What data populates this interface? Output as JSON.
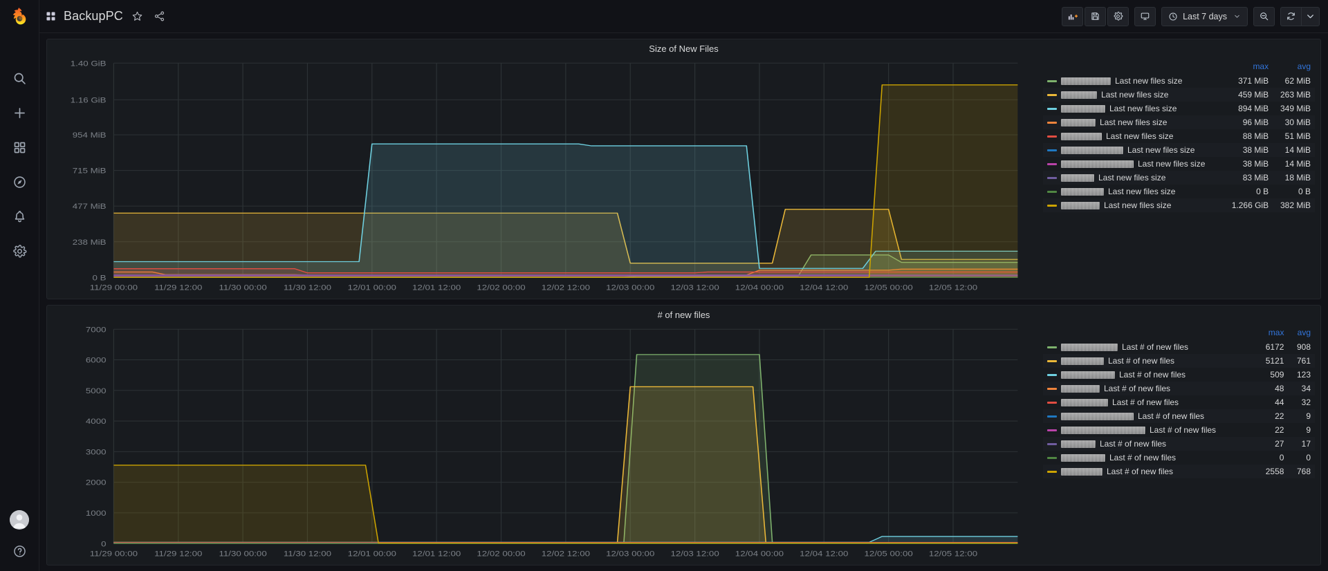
{
  "app": {
    "logo": "grafana-logo",
    "dashboard_title": "BackupPC"
  },
  "sidebar": {
    "items": [
      {
        "name": "search-icon",
        "label": "Search"
      },
      {
        "name": "plus-icon",
        "label": "Create"
      },
      {
        "name": "dashboards-icon",
        "label": "Dashboards"
      },
      {
        "name": "compass-icon",
        "label": "Explore"
      },
      {
        "name": "bell-icon",
        "label": "Alerting"
      },
      {
        "name": "gear-icon",
        "label": "Configuration"
      }
    ],
    "bottom": [
      {
        "name": "avatar",
        "label": "User"
      },
      {
        "name": "help-icon",
        "label": "Help"
      }
    ]
  },
  "navbar": {
    "grid_icon": "dashboard-grid-icon",
    "title": "BackupPC",
    "star_icon": "star-icon",
    "share_icon": "share-icon",
    "buttons": [
      {
        "name": "add-panel-button",
        "icon": "add-panel-icon",
        "label": "Add panel"
      },
      {
        "name": "save-dashboard-button",
        "icon": "save-icon",
        "label": "Save dashboard"
      },
      {
        "name": "dashboard-settings-button",
        "icon": "gear-icon",
        "label": "Dashboard settings"
      },
      {
        "name": "cycle-view-mode-button",
        "icon": "tv-icon",
        "label": "Cycle view mode"
      }
    ],
    "time_picker": {
      "icon": "clock-icon",
      "value": "Last 7 days",
      "caret": "chevron-down-icon"
    },
    "zoom_out_button": {
      "icon": "zoom-out-icon",
      "label": "Zoom out time range"
    },
    "refresh_button": {
      "icon": "refresh-icon",
      "label": "Refresh dashboard"
    },
    "refresh_interval_caret": {
      "icon": "chevron-down-icon",
      "label": "Set auto refresh interval"
    }
  },
  "colors": {
    "accent_blue": "#3274d9",
    "green": "#7eb26d",
    "yellow": "#eab839",
    "cyan": "#6ed0e0",
    "orange": "#ef843c",
    "red": "#e24d42",
    "blue": "#1f78c1",
    "magenta": "#ba43a9",
    "purple": "#705da0",
    "dark_green": "#508642",
    "dark_yellow": "#cca300",
    "panel_bg": "#181b1f",
    "page_bg": "#111217"
  },
  "panels": [
    {
      "title": "Size of New Files",
      "legend_headers": {
        "label": "",
        "max": "max",
        "avg": "avg"
      },
      "legend": [
        {
          "color": "#7eb26d",
          "redacted_width": 72,
          "label": "Last new files size",
          "max": "371 MiB",
          "avg": "62 MiB"
        },
        {
          "color": "#eab839",
          "redacted_width": 52,
          "label": "Last new files size",
          "max": "459 MiB",
          "avg": "263 MiB"
        },
        {
          "color": "#6ed0e0",
          "redacted_width": 64,
          "label": "Last new files size",
          "max": "894 MiB",
          "avg": "349 MiB"
        },
        {
          "color": "#ef843c",
          "redacted_width": 50,
          "label": "Last new files size",
          "max": "96 MiB",
          "avg": "30 MiB"
        },
        {
          "color": "#e24d42",
          "redacted_width": 59,
          "label": "Last new files size",
          "max": "88 MiB",
          "avg": "51 MiB"
        },
        {
          "color": "#1f78c1",
          "redacted_width": 90,
          "label": "Last new files size",
          "max": "38 MiB",
          "avg": "14 MiB"
        },
        {
          "color": "#ba43a9",
          "redacted_width": 105,
          "label": "Last new files size",
          "max": "38 MiB",
          "avg": "14 MiB"
        },
        {
          "color": "#705da0",
          "redacted_width": 48,
          "label": "Last new files size",
          "max": "83 MiB",
          "avg": "18 MiB"
        },
        {
          "color": "#508642",
          "redacted_width": 62,
          "label": "Last new files size",
          "max": "0 B",
          "avg": "0 B"
        },
        {
          "color": "#cca300",
          "redacted_width": 56,
          "label": "Last new files size",
          "max": "1.266 GiB",
          "avg": "382 MiB"
        }
      ]
    },
    {
      "title": "# of new files",
      "legend_headers": {
        "label": "",
        "max": "max",
        "avg": "avg"
      },
      "legend": [
        {
          "color": "#7eb26d",
          "redacted_width": 82,
          "label": "Last # of new files",
          "max": "6172",
          "avg": "908"
        },
        {
          "color": "#eab839",
          "redacted_width": 62,
          "label": "Last # of new files",
          "max": "5121",
          "avg": "761"
        },
        {
          "color": "#6ed0e0",
          "redacted_width": 78,
          "label": "Last # of new files",
          "max": "509",
          "avg": "123"
        },
        {
          "color": "#ef843c",
          "redacted_width": 56,
          "label": "Last # of new files",
          "max": "48",
          "avg": "34"
        },
        {
          "color": "#e24d42",
          "redacted_width": 68,
          "label": "Last # of new files",
          "max": "44",
          "avg": "32"
        },
        {
          "color": "#1f78c1",
          "redacted_width": 105,
          "label": "Last # of new files",
          "max": "22",
          "avg": "9"
        },
        {
          "color": "#ba43a9",
          "redacted_width": 122,
          "label": "Last # of new files",
          "max": "22",
          "avg": "9"
        },
        {
          "color": "#705da0",
          "redacted_width": 50,
          "label": "Last # of new files",
          "max": "27",
          "avg": "17"
        },
        {
          "color": "#508642",
          "redacted_width": 64,
          "label": "Last # of new files",
          "max": "0",
          "avg": "0"
        },
        {
          "color": "#cca300",
          "redacted_width": 60,
          "label": "Last # of new files",
          "max": "2558",
          "avg": "768"
        }
      ]
    }
  ],
  "chart_data": [
    {
      "type": "area",
      "title": "Size of New Files",
      "xlabel": "",
      "ylabel": "",
      "grid": true,
      "legend_position": "right",
      "y_ticks": [
        "0 B",
        "238 MiB",
        "477 MiB",
        "715 MiB",
        "954 MiB",
        "1.16 GiB",
        "1.40 GiB"
      ],
      "y_tick_values": [
        0,
        238,
        477,
        715,
        954,
        1188,
        1434
      ],
      "ylim": [
        0,
        1434
      ],
      "y_unit": "MiB",
      "x_ticks": [
        "11/29 00:00",
        "11/29 12:00",
        "11/30 00:00",
        "11/30 12:00",
        "12/01 00:00",
        "12/01 12:00",
        "12/02 00:00",
        "12/02 12:00",
        "12/03 00:00",
        "12/03 12:00",
        "12/04 00:00",
        "12/04 12:00",
        "12/05 00:00",
        "12/05 12:00"
      ],
      "x": [
        0,
        0.5,
        1,
        1.5,
        2,
        2.5,
        3,
        3.5,
        4,
        4.5,
        5,
        5.5,
        6,
        6.5,
        7
      ],
      "series": [
        {
          "name": "Last new files size",
          "color": "#7eb26d",
          "max": 371,
          "avg": 62,
          "points": [
            [
              0,
              2
            ],
            [
              3.95,
              2
            ],
            [
              4.05,
              8
            ],
            [
              5.3,
              8
            ],
            [
              5.4,
              150
            ],
            [
              6.0,
              150
            ],
            [
              6.1,
              100
            ],
            [
              7.0,
              100
            ]
          ]
        },
        {
          "name": "Last new files size",
          "color": "#eab839",
          "max": 459,
          "avg": 263,
          "points": [
            [
              0,
              430
            ],
            [
              3.9,
              430
            ],
            [
              4.0,
              95
            ],
            [
              5.1,
              95
            ],
            [
              5.2,
              455
            ],
            [
              6.0,
              455
            ],
            [
              6.1,
              120
            ],
            [
              7.0,
              120
            ]
          ]
        },
        {
          "name": "Last new files size",
          "color": "#6ed0e0",
          "max": 894,
          "avg": 349,
          "points": [
            [
              0,
              105
            ],
            [
              1.9,
              105
            ],
            [
              2.0,
              893
            ],
            [
              3.6,
              893
            ],
            [
              3.7,
              880
            ],
            [
              4.9,
              880
            ],
            [
              5.0,
              60
            ],
            [
              5.8,
              60
            ],
            [
              5.9,
              175
            ],
            [
              7.0,
              175
            ]
          ]
        },
        {
          "name": "Last new files size",
          "color": "#ef843c",
          "max": 96,
          "avg": 30,
          "points": [
            [
              0,
              36
            ],
            [
              0.3,
              36
            ],
            [
              0.4,
              18
            ],
            [
              1.4,
              18
            ],
            [
              1.5,
              16
            ],
            [
              4.9,
              16
            ],
            [
              5.0,
              48
            ],
            [
              6.0,
              48
            ],
            [
              6.1,
              55
            ],
            [
              7.0,
              55
            ]
          ]
        },
        {
          "name": "Last new files size",
          "color": "#e24d42",
          "max": 88,
          "avg": 51,
          "points": [
            [
              0,
              58
            ],
            [
              1.4,
              58
            ],
            [
              1.5,
              30
            ],
            [
              4.5,
              30
            ],
            [
              4.6,
              36
            ],
            [
              7.0,
              36
            ]
          ]
        },
        {
          "name": "Last new files size",
          "color": "#1f78c1",
          "max": 38,
          "avg": 14,
          "points": [
            [
              0,
              13
            ],
            [
              7.0,
              13
            ]
          ]
        },
        {
          "name": "Last new files size",
          "color": "#ba43a9",
          "max": 38,
          "avg": 14,
          "points": [
            [
              0,
              12
            ],
            [
              7.0,
              12
            ]
          ]
        },
        {
          "name": "Last new files size",
          "color": "#705da0",
          "max": 83,
          "avg": 18,
          "points": [
            [
              0,
              16
            ],
            [
              7.0,
              16
            ]
          ]
        },
        {
          "name": "Last new files size",
          "color": "#508642",
          "max": 0,
          "avg": 0,
          "points": [
            [
              0,
              0
            ],
            [
              7.0,
              0
            ]
          ]
        },
        {
          "name": "Last new files size",
          "color": "#cca300",
          "max": 1296,
          "avg": 382,
          "points": [
            [
              0,
              0
            ],
            [
              5.85,
              0
            ],
            [
              5.95,
              1288
            ],
            [
              7.0,
              1288
            ]
          ]
        }
      ]
    },
    {
      "type": "area",
      "title": "# of new files",
      "xlabel": "",
      "ylabel": "",
      "grid": true,
      "legend_position": "right",
      "y_ticks": [
        "0",
        "1000",
        "2000",
        "3000",
        "4000",
        "5000",
        "6000",
        "7000"
      ],
      "y_tick_values": [
        0,
        1000,
        2000,
        3000,
        4000,
        5000,
        6000,
        7000
      ],
      "ylim": [
        0,
        7000
      ],
      "x_ticks": [
        "11/29 00:00",
        "11/29 12:00",
        "11/30 00:00",
        "11/30 12:00",
        "12/01 00:00",
        "12/01 12:00",
        "12/02 00:00",
        "12/02 12:00",
        "12/03 00:00",
        "12/03 12:00",
        "12/04 00:00",
        "12/04 12:00",
        "12/05 00:00",
        "12/05 12:00"
      ],
      "x": [
        0,
        0.5,
        1,
        1.5,
        2,
        2.5,
        3,
        3.5,
        4,
        4.5,
        5,
        5.5,
        6,
        6.5,
        7
      ],
      "series": [
        {
          "name": "Last # of new files",
          "color": "#7eb26d",
          "max": 6172,
          "avg": 908,
          "points": [
            [
              0,
              20
            ],
            [
              3.95,
              20
            ],
            [
              4.05,
              6172
            ],
            [
              5.0,
              6172
            ],
            [
              5.1,
              30
            ],
            [
              7.0,
              30
            ]
          ]
        },
        {
          "name": "Last # of new files",
          "color": "#eab839",
          "max": 5121,
          "avg": 761,
          "points": [
            [
              0,
              30
            ],
            [
              3.9,
              30
            ],
            [
              4.0,
              5121
            ],
            [
              4.95,
              5121
            ],
            [
              5.05,
              25
            ],
            [
              7.0,
              25
            ]
          ]
        },
        {
          "name": "Last # of new files",
          "color": "#6ed0e0",
          "max": 509,
          "avg": 123,
          "points": [
            [
              0,
              40
            ],
            [
              5.85,
              40
            ],
            [
              5.95,
              230
            ],
            [
              7.0,
              230
            ]
          ]
        },
        {
          "name": "Last # of new files",
          "color": "#ef843c",
          "max": 48,
          "avg": 34,
          "points": [
            [
              0,
              34
            ],
            [
              7.0,
              34
            ]
          ]
        },
        {
          "name": "Last # of new files",
          "color": "#e24d42",
          "max": 44,
          "avg": 32,
          "points": [
            [
              0,
              32
            ],
            [
              7.0,
              32
            ]
          ]
        },
        {
          "name": "Last # of new files",
          "color": "#1f78c1",
          "max": 22,
          "avg": 9,
          "points": [
            [
              0,
              9
            ],
            [
              7.0,
              9
            ]
          ]
        },
        {
          "name": "Last # of new files",
          "color": "#ba43a9",
          "max": 22,
          "avg": 9,
          "points": [
            [
              0,
              9
            ],
            [
              7.0,
              9
            ]
          ]
        },
        {
          "name": "Last # of new files",
          "color": "#705da0",
          "max": 27,
          "avg": 17,
          "points": [
            [
              0,
              17
            ],
            [
              7.0,
              17
            ]
          ]
        },
        {
          "name": "Last # of new files",
          "color": "#508642",
          "max": 0,
          "avg": 0,
          "points": [
            [
              0,
              0
            ],
            [
              7.0,
              0
            ]
          ]
        },
        {
          "name": "Last # of new files",
          "color": "#cca300",
          "max": 2558,
          "avg": 768,
          "points": [
            [
              0,
              2558
            ],
            [
              1.95,
              2558
            ],
            [
              2.05,
              15
            ],
            [
              7.0,
              15
            ]
          ]
        }
      ]
    }
  ]
}
